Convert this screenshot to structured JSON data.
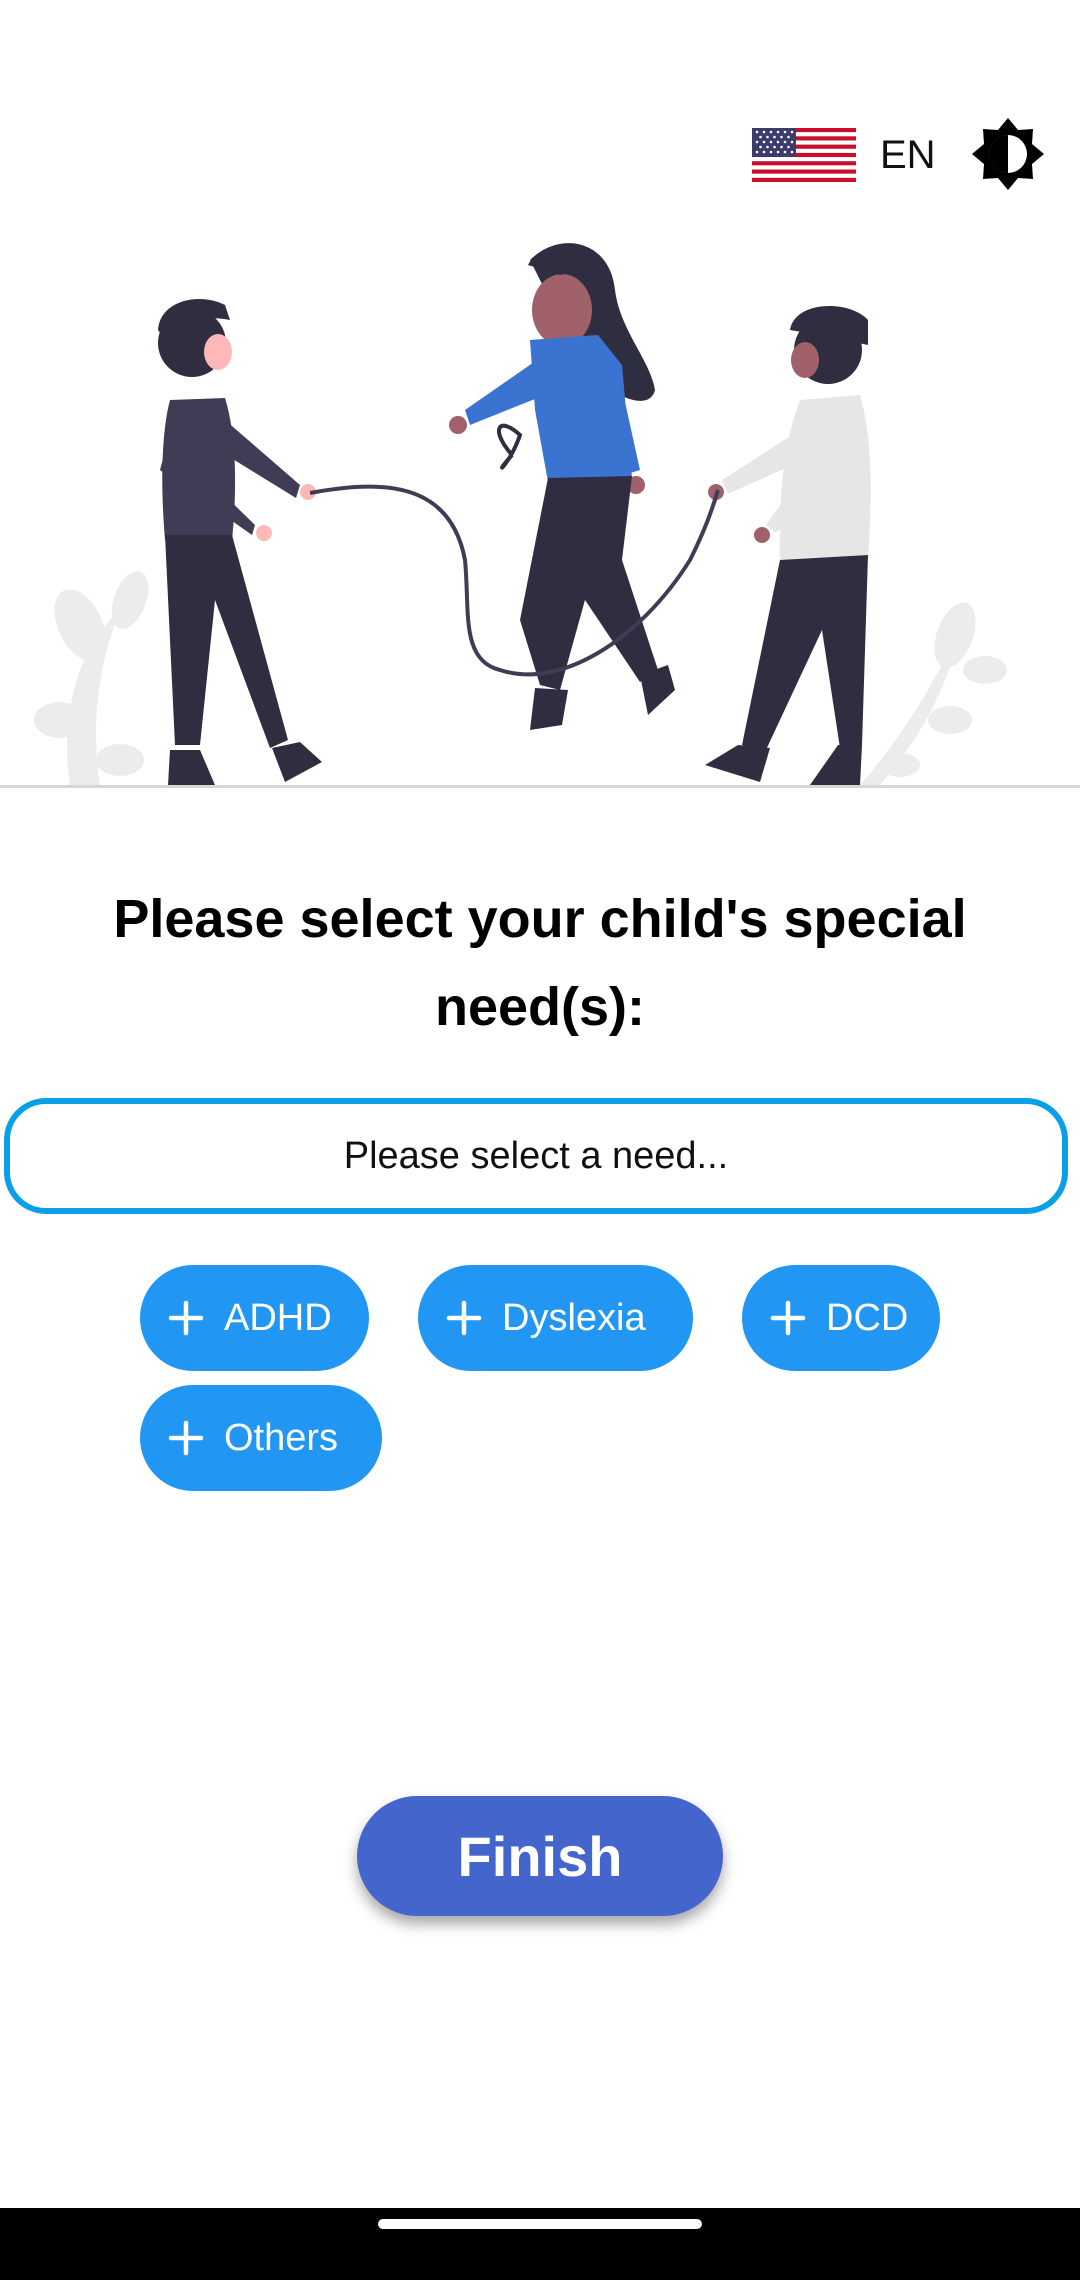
{
  "language": {
    "code": "EN",
    "flag_icon": "us-flag-icon"
  },
  "theme_toggle": {
    "icon": "brightness-icon"
  },
  "hero": {
    "icon": "children-jump-rope-illustration"
  },
  "title": "Please select your child's special need(s):",
  "select": {
    "placeholder": "Please select a need...",
    "border_color": "#0aa0e8"
  },
  "chips": [
    {
      "label": "ADHD",
      "icon": "plus-icon"
    },
    {
      "label": "Dyslexia",
      "icon": "plus-icon"
    },
    {
      "label": "DCD",
      "icon": "plus-icon"
    },
    {
      "label": "Others",
      "icon": "plus-icon"
    }
  ],
  "chip_color": "#2196f3",
  "finish_button": {
    "label": "Finish",
    "color": "#4466cc"
  }
}
